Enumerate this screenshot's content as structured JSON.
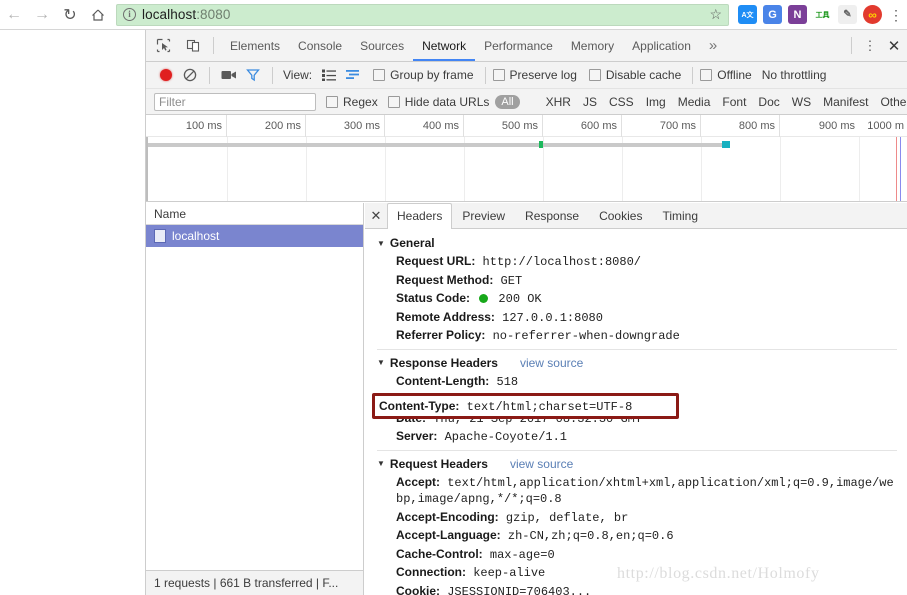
{
  "browser": {
    "back_icon": "back-arrow-icon",
    "forward_icon": "forward-arrow-icon",
    "reload_icon": "reload-icon",
    "home_icon": "home-icon",
    "info_glyph": "i",
    "url_host": "localhost",
    "url_port": ":8080",
    "star_glyph": "☆",
    "extensions": [
      {
        "name": "translate-extension",
        "label": "A文",
        "color": "#2196f3"
      },
      {
        "name": "google-translate-extension",
        "label": "G",
        "color": "#4285f4"
      },
      {
        "name": "onenote-extension",
        "label": "N",
        "color": "#7b3f98"
      },
      {
        "name": "devtip-extension",
        "label": "工具",
        "color": "#ffffff"
      },
      {
        "name": "pen-extension",
        "label": "✒",
        "color": "#f0f0f0"
      },
      {
        "name": "infinity-extension",
        "label": "∞",
        "color": "#e53935"
      }
    ],
    "menu_glyph": "⋮"
  },
  "devtools": {
    "inspect_icon": "inspect-element-icon",
    "device_icon": "device-toolbar-icon",
    "tabs": [
      {
        "label": "Elements",
        "selected": false
      },
      {
        "label": "Console",
        "selected": false
      },
      {
        "label": "Sources",
        "selected": false
      },
      {
        "label": "Network",
        "selected": true
      },
      {
        "label": "Performance",
        "selected": false
      },
      {
        "label": "Memory",
        "selected": false
      },
      {
        "label": "Application",
        "selected": false
      }
    ],
    "more_tabs_glyph": "»",
    "kebab_glyph": "⋮",
    "close_glyph": "✕"
  },
  "network_toolbar": {
    "record_button": "record-button",
    "clear_button": "clear-button",
    "capture_screenshots_button": "camera-button",
    "filter_button": "funnel-button",
    "view_label": "View:",
    "view_list_icon": "list-view-icon",
    "view_waterfall_icon": "waterfall-view-icon",
    "group_by_frame_label": "Group by frame",
    "preserve_log_label": "Preserve log",
    "disable_cache_label": "Disable cache",
    "offline_label": "Offline",
    "throttling_label": "No throttling"
  },
  "filter_row": {
    "filter_placeholder": "Filter",
    "regex_label": "Regex",
    "hide_data_urls_label": "Hide data URLs",
    "all_pill": "All",
    "types": [
      "XHR",
      "JS",
      "CSS",
      "Img",
      "Media",
      "Font",
      "Doc",
      "WS",
      "Manifest",
      "Other"
    ]
  },
  "overview": {
    "ticks": [
      "100 ms",
      "200 ms",
      "300 ms",
      "400 ms",
      "500 ms",
      "600 ms",
      "700 ms",
      "800 ms",
      "900 ms",
      "1000 m"
    ],
    "bar_color": "#c9c9c9",
    "marker_green": "#1cb85c",
    "marker_teal": "#17b0c0",
    "dcl_color": "#ee8a8a",
    "load_color": "#8a8aee"
  },
  "request_list": {
    "column_header": "Name",
    "rows": [
      {
        "name": "localhost",
        "selected": true
      }
    ],
    "status_bar": "1 requests | 661 B transferred | F..."
  },
  "detail": {
    "close_glyph": "✕",
    "tabs": [
      {
        "label": "Headers",
        "selected": true
      },
      {
        "label": "Preview",
        "selected": false
      },
      {
        "label": "Response",
        "selected": false
      },
      {
        "label": "Cookies",
        "selected": false
      },
      {
        "label": "Timing",
        "selected": false
      }
    ],
    "view_source_label": "view source",
    "sections": [
      {
        "title": "General",
        "has_view_source": false,
        "rows": [
          {
            "key": "Request URL:",
            "value": "http://localhost:8080/"
          },
          {
            "key": "Request Method:",
            "value": "GET"
          },
          {
            "key": "Status Code:",
            "value": "200 OK",
            "status_dot": true
          },
          {
            "key": "Remote Address:",
            "value": "127.0.0.1:8080"
          },
          {
            "key": "Referrer Policy:",
            "value": "no-referrer-when-downgrade"
          }
        ]
      },
      {
        "title": "Response Headers",
        "has_view_source": true,
        "rows": [
          {
            "key": "Content-Length:",
            "value": "518",
            "clipped": true
          },
          {
            "key": "Content-Type:",
            "value": "text/html;charset=UTF-8",
            "highlighted": true
          },
          {
            "key": "Date:",
            "value": "Thu, 21 Sep 2017 08:32:30 GMT",
            "clipped": true
          },
          {
            "key": "Server:",
            "value": "Apache-Coyote/1.1"
          }
        ]
      },
      {
        "title": "Request Headers",
        "has_view_source": true,
        "rows": [
          {
            "key": "Accept:",
            "value": "text/html,application/xhtml+xml,application/xml;q=0.9,image/webp,image/apng,*/*;q=0.8"
          },
          {
            "key": "Accept-Encoding:",
            "value": "gzip, deflate, br"
          },
          {
            "key": "Accept-Language:",
            "value": "zh-CN,zh;q=0.8,en;q=0.6"
          },
          {
            "key": "Cache-Control:",
            "value": "max-age=0"
          },
          {
            "key": "Connection:",
            "value": "keep-alive"
          },
          {
            "key": "Cookie:",
            "value": "JSESSIONID=706403...",
            "cut_off": true
          }
        ]
      }
    ],
    "highlight_box": {
      "key": "Content-Type:",
      "value": "text/html;charset=UTF-8",
      "border_color": "#8b1a15"
    }
  },
  "watermark": "http://blog.csdn.net/Holmofy"
}
